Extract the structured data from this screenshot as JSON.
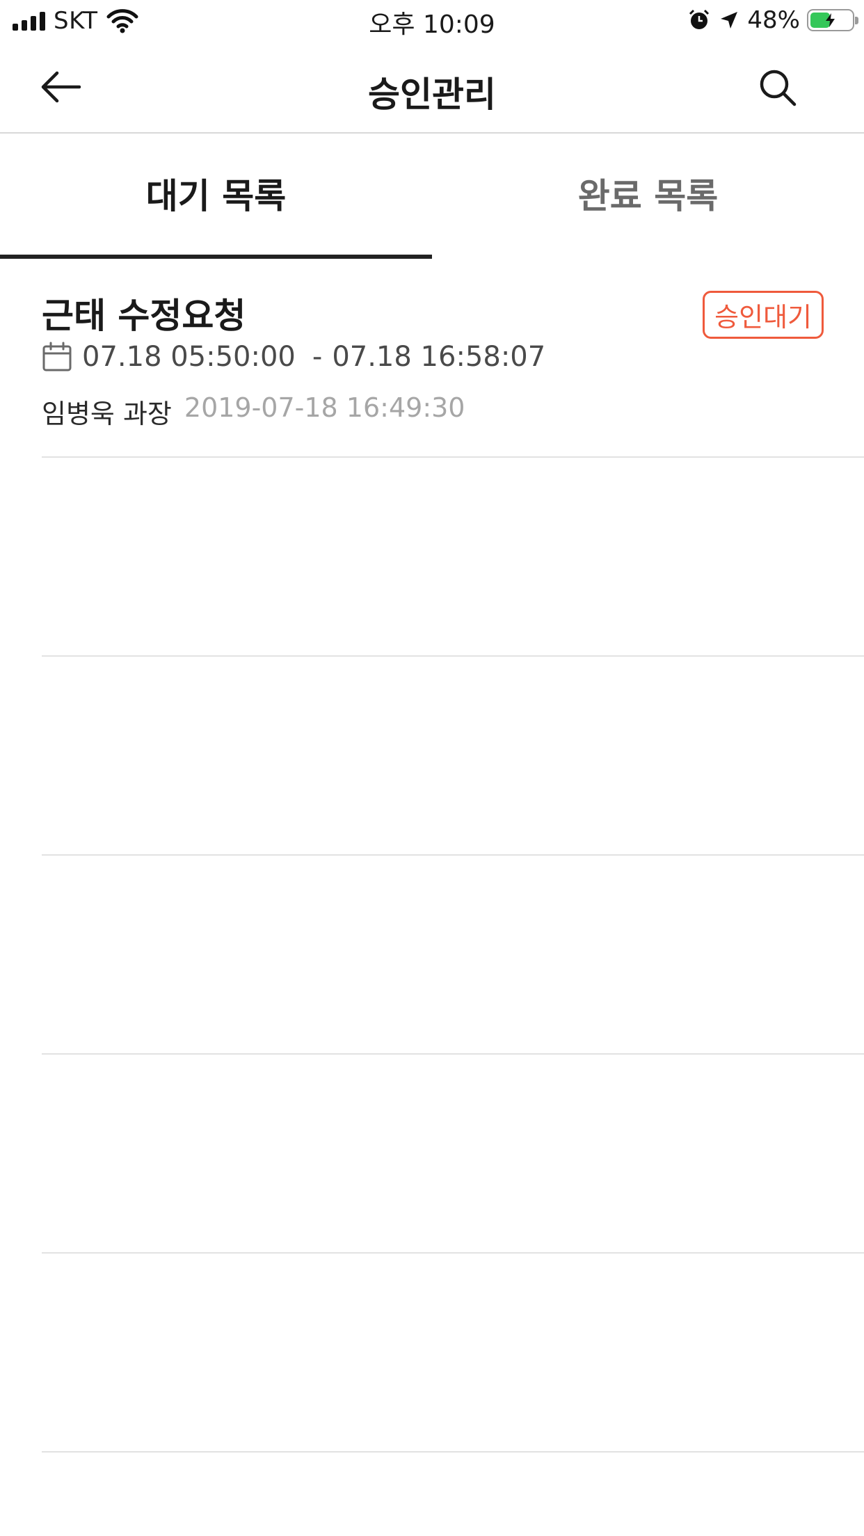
{
  "status_bar": {
    "carrier": "SKT",
    "time": "오후 10:09",
    "battery_percent": "48%",
    "battery_level": 0.48,
    "battery_color": "#34c759",
    "icons": [
      "signal-icon",
      "wifi-icon",
      "alarm-icon",
      "location-arrow-icon",
      "battery-icon"
    ]
  },
  "nav": {
    "title": "승인관리",
    "back_icon": "arrow-left-icon",
    "search_icon": "search-icon"
  },
  "tabs": [
    {
      "label": "대기 목록",
      "active": true
    },
    {
      "label": "완료 목록",
      "active": false
    }
  ],
  "requests": [
    {
      "title": "근태 수정요청",
      "status": "승인대기",
      "date_start": "07.18 05:50:00",
      "date_separator": "-",
      "date_end": "07.18 16:58:07",
      "requester": "임병욱 과장",
      "requested_at": "2019-07-18 16:49:30"
    }
  ],
  "colors": {
    "accent": "#ef5a3c",
    "tab_indicator": "#222222"
  }
}
